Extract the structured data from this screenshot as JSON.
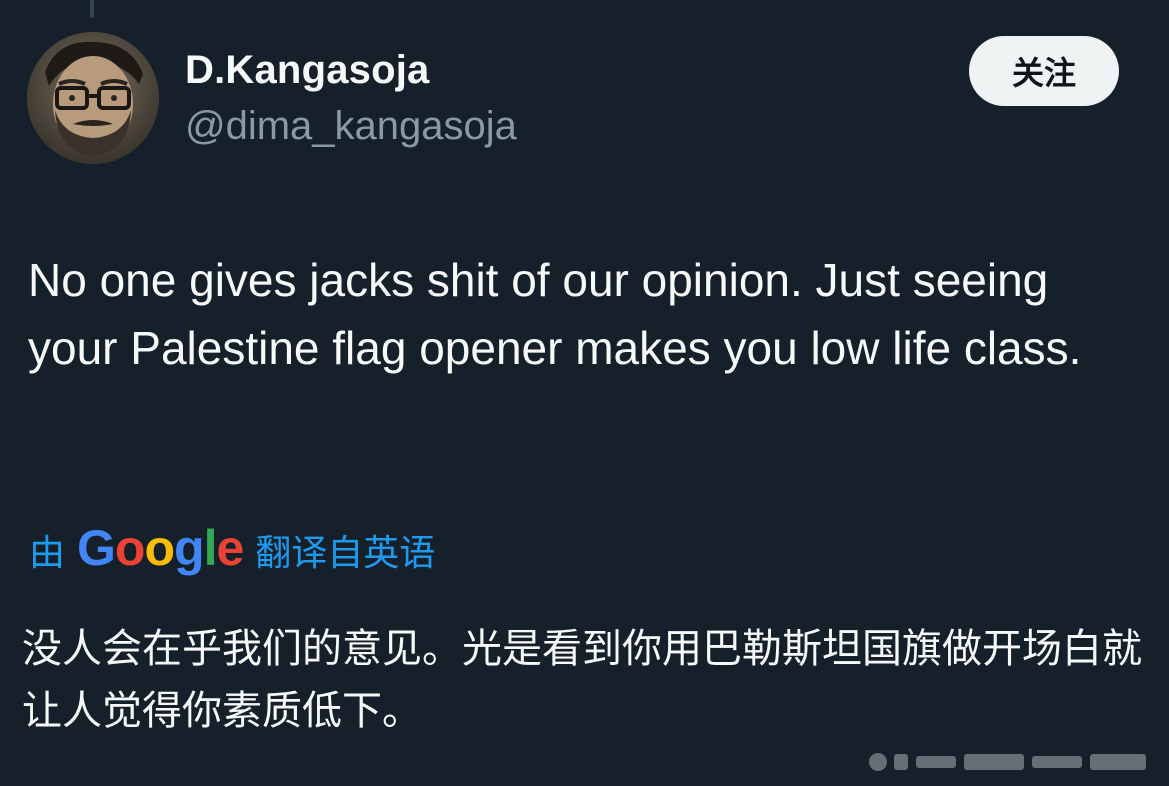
{
  "author": {
    "display_name": "D.Kangasoja",
    "handle": "@dima_kangasoja"
  },
  "follow_button": {
    "label": "关注"
  },
  "tweet": {
    "text": "No one gives jacks shit of our opinion. Just seeing your Palestine flag opener makes you low life class."
  },
  "translation": {
    "prefix": "由",
    "logo_letters": [
      "G",
      "o",
      "o",
      "g",
      "l",
      "e"
    ],
    "suffix": "翻译自英语",
    "text": "没人会在乎我们的意见。光是看到你用巴勒斯坦国旗做开场白就让人觉得你素质低下。"
  },
  "colors": {
    "background": "#15202b",
    "text_primary": "#f7f9f9",
    "text_secondary": "#8b98a5",
    "link": "#1d9bf0",
    "button_bg": "#eff3f4",
    "button_text": "#0f1419"
  }
}
